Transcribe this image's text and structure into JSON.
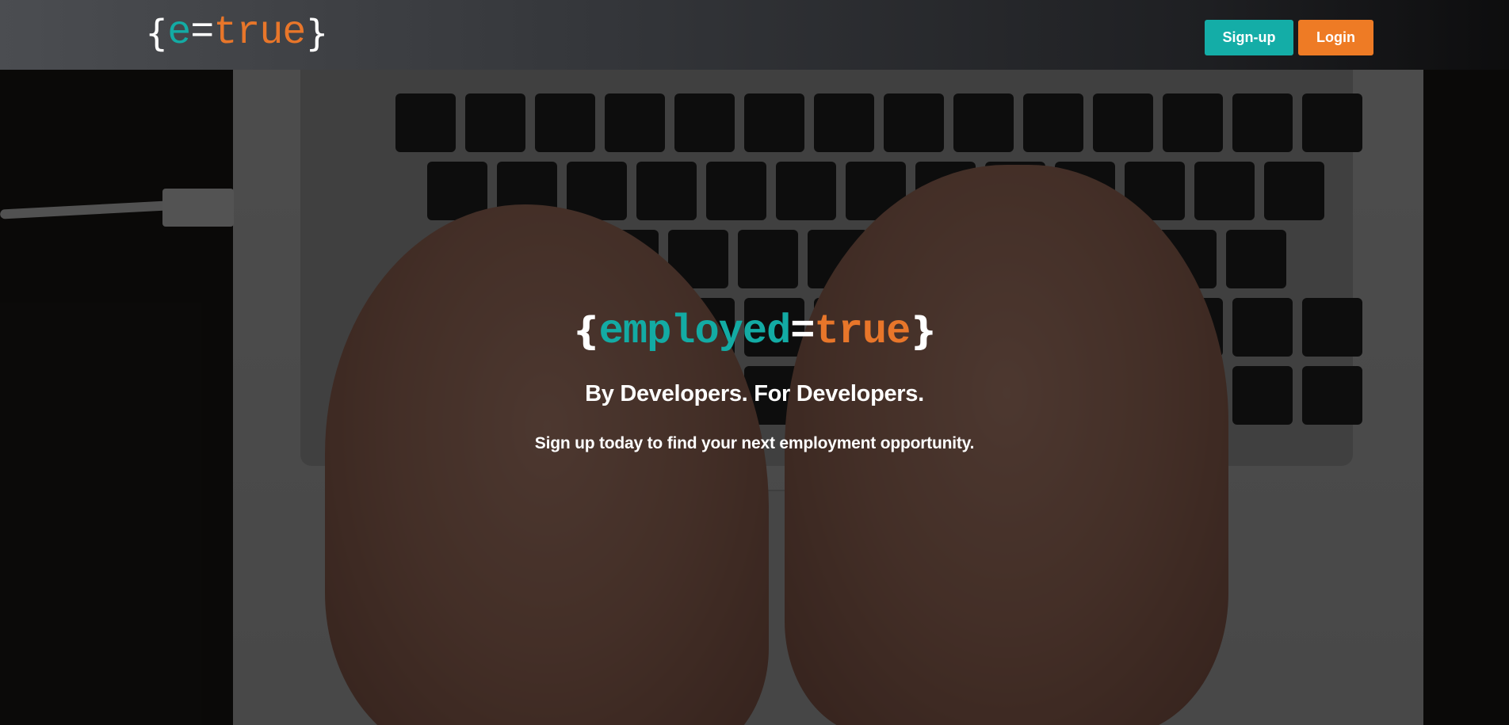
{
  "header": {
    "brand": {
      "open_brace": "{",
      "left": "e",
      "equals": "=",
      "right": "true",
      "close_brace": "}"
    },
    "signup_label": "Sign-up",
    "login_label": "Login"
  },
  "hero": {
    "logo": {
      "open_brace": "{",
      "left": "employed",
      "equals": "=",
      "right": "true",
      "close_brace": "}"
    },
    "tagline": "By Developers. For Developers.",
    "subtext": "Sign up today to find your next employment opportunity."
  },
  "colors": {
    "teal": "#14ada7",
    "orange": "#ee7b25"
  }
}
